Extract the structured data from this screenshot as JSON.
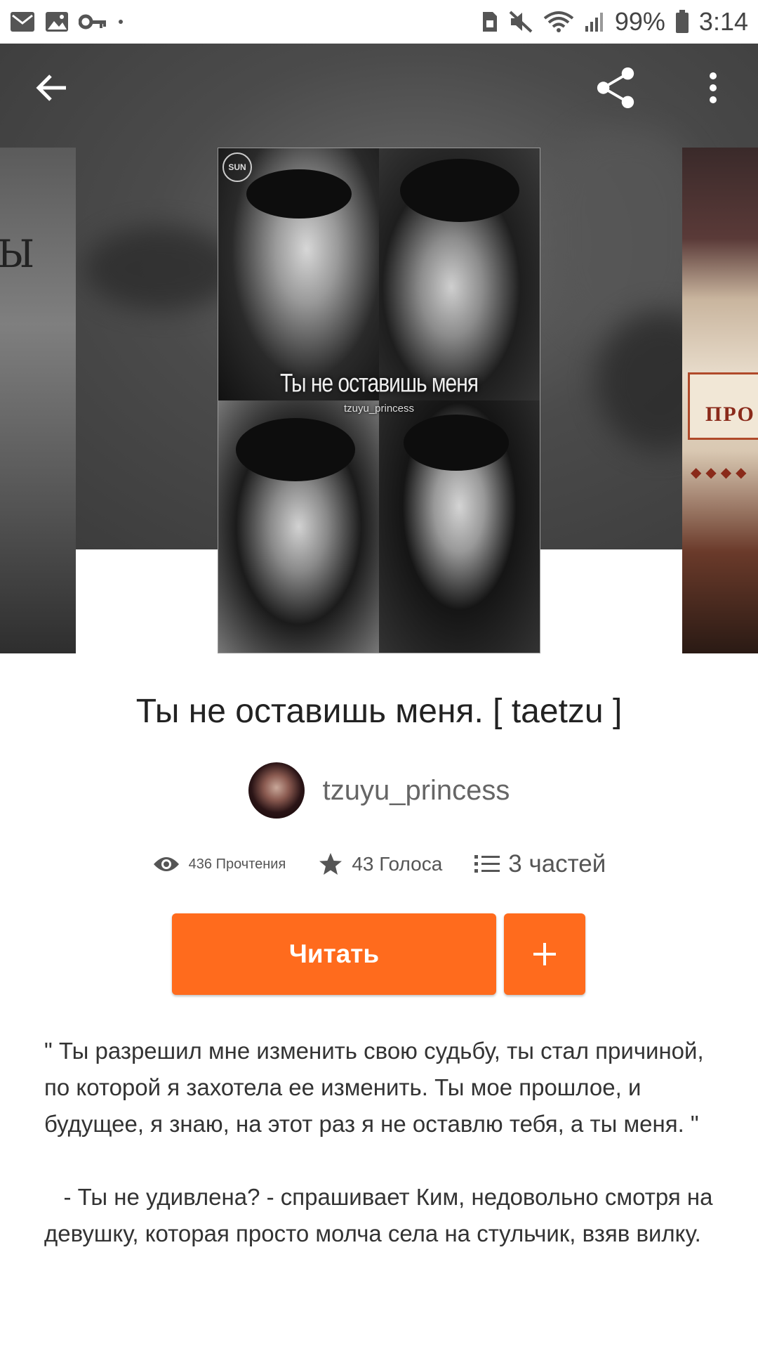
{
  "status_bar": {
    "battery_percent": "99%",
    "time": "3:14",
    "left_icons": [
      "mail-icon",
      "image-icon",
      "key-icon",
      "dot-icon"
    ],
    "right_icons": [
      "sim-icon",
      "mute-icon",
      "wifi-icon",
      "signal-icon",
      "battery-icon"
    ]
  },
  "toolbar": {
    "back_icon": "arrow-left-icon",
    "share_icon": "share-icon",
    "more_icon": "more-vertical-icon"
  },
  "cover": {
    "logo": "SUN",
    "title": "Ты не оставишь меня",
    "author": "tzuyu_princess"
  },
  "story": {
    "title": "Ты не оставишь меня. [ taetzu ]",
    "author": "tzuyu_princess",
    "reads": "436 Прочтения",
    "votes": "43 Голоса",
    "parts": "3 частей",
    "read_button": "Читать",
    "add_button_icon": "plus-icon",
    "description": "\" Ты разрешил мне изменить свою судьбу, ты стал причиной, по которой я захотела ее изменить. Ты мое прошлое, и будущее, я знаю, на этот раз я не оставлю тебя, а ты меня. \"\n\n   - Ты не удивлена? - спрашивает Ким, недовольно смотря на девушку, которая просто молча села на стульчик, взяв вилку."
  },
  "colors": {
    "accent": "#ff6b1d",
    "hero_background": "#4b4b4b",
    "text_primary": "#222222",
    "text_secondary": "#666666"
  }
}
